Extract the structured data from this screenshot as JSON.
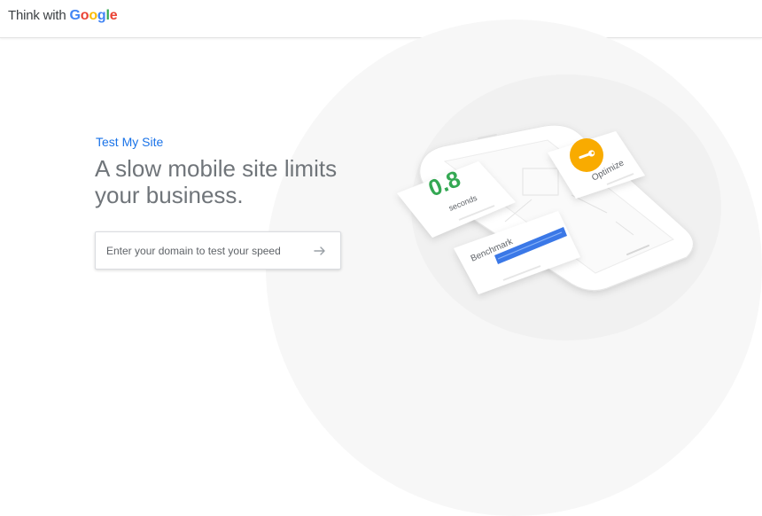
{
  "header": {
    "logo_prefix": "Think with",
    "logo_letters": [
      "G",
      "o",
      "o",
      "g",
      "l",
      "e"
    ]
  },
  "hero": {
    "eyebrow": "Test My Site",
    "headline": "A slow mobile site limits your business.",
    "search_placeholder": "Enter your domain to test your speed"
  },
  "illustration": {
    "speed_value": "0.8",
    "speed_unit": "seconds",
    "optimize_label": "Optimize",
    "benchmark_label": "Benchmark"
  },
  "colors": {
    "google_blue": "#4285F4",
    "google_red": "#EA4335",
    "google_yellow": "#FBBC05",
    "google_green": "#34A853",
    "link_blue": "#1a73e8"
  },
  "icons": {
    "submit": "arrow-right-icon",
    "optimize": "wrench-icon"
  }
}
